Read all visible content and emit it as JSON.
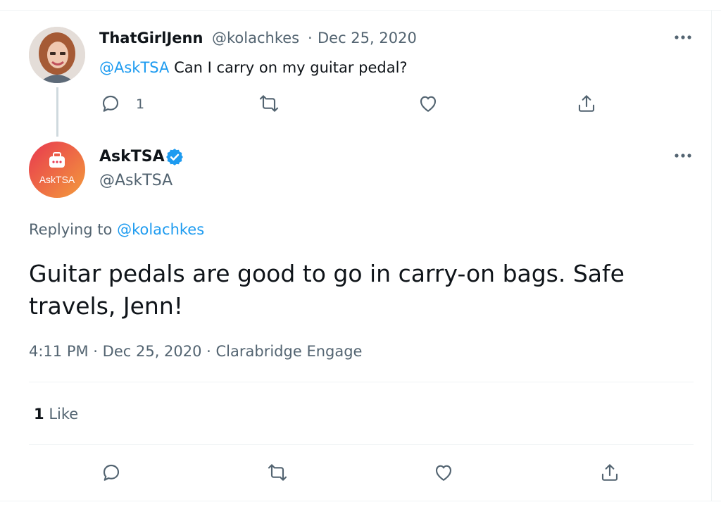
{
  "reply_tweet": {
    "author_name": "ThatGirlJenn",
    "author_handle": "@kolachkes",
    "separator": "·",
    "date": "Dec 25, 2020",
    "mention": "@AskTSA",
    "text": " Can I carry on my guitar pedal?",
    "reply_count": "1"
  },
  "main_tweet": {
    "author_name": "AskTSA",
    "author_handle": "@AskTSA",
    "avatar_label_a": "Ask",
    "avatar_label_b": "TSA",
    "replying_prefix": "Replying to ",
    "replying_handle": "@kolachkes",
    "text": "Guitar pedals are good to go in carry-on bags. Safe travels, Jenn!",
    "time": "4:11 PM",
    "sep1": " · ",
    "date": "Dec 25, 2020",
    "sep2": " · ",
    "source": "Clarabridge Engage",
    "like_count": "1",
    "like_label": "Like"
  },
  "icons": [
    "more-icon",
    "reply-icon",
    "retweet-icon",
    "like-icon",
    "share-icon",
    "verified-badge-icon"
  ],
  "colors": {
    "link": "#1d9bf0",
    "text": "#0f1419",
    "muted": "#536471",
    "avatar_gradient_start": "#e8384f",
    "avatar_gradient_end": "#f39c3c"
  }
}
